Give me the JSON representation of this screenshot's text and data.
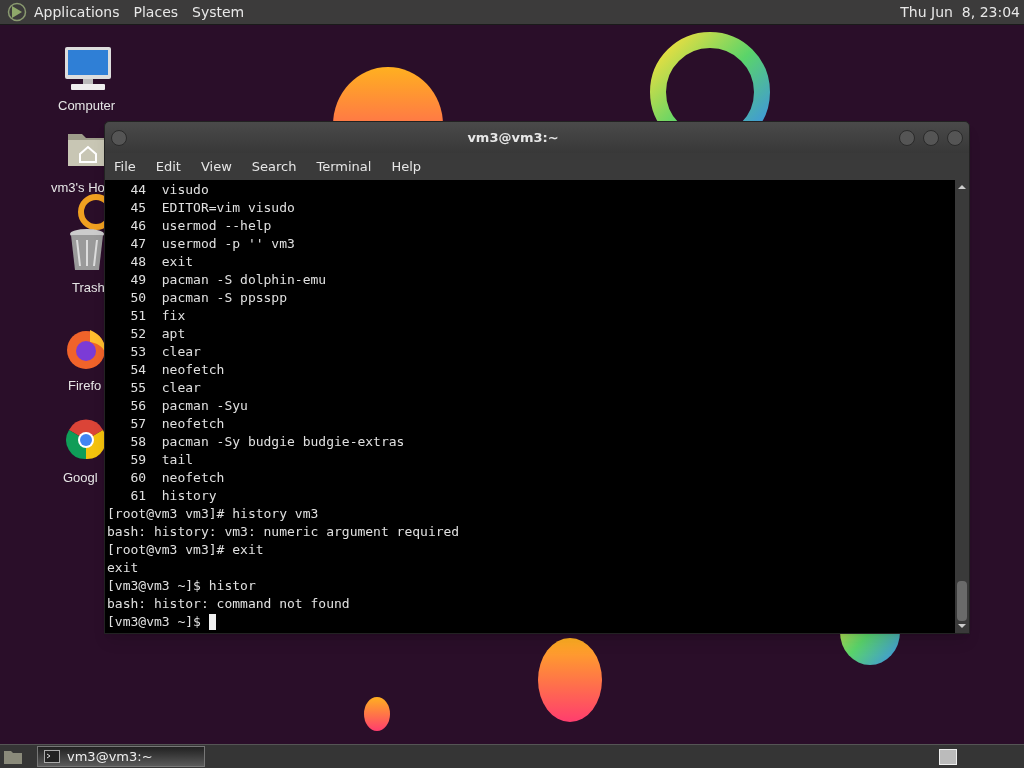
{
  "top_panel": {
    "menus": [
      "Applications",
      "Places",
      "System"
    ],
    "clock": "Thu Jun  8, 23:04"
  },
  "desktop_icons": [
    {
      "label": "Computer",
      "kind": "computer"
    },
    {
      "label": "vm3's Ho",
      "kind": "home"
    },
    {
      "label": "Trash",
      "kind": "trash"
    },
    {
      "label": "Firefo",
      "kind": "firefox"
    },
    {
      "label": "Googl",
      "kind": "chrome"
    }
  ],
  "window": {
    "title": "vm3@vm3:~",
    "menu": [
      "File",
      "Edit",
      "View",
      "Search",
      "Terminal",
      "Help"
    ],
    "lines": [
      "   44  visudo",
      "   45  EDITOR=vim visudo",
      "   46  usermod --help",
      "   47  usermod -p '' vm3",
      "   48  exit",
      "   49  pacman -S dolphin-emu",
      "   50  pacman -S ppsspp",
      "   51  fix",
      "   52  apt",
      "   53  clear",
      "   54  neofetch",
      "   55  clear",
      "   56  pacman -Syu",
      "   57  neofetch",
      "   58  pacman -Sy budgie budgie-extras",
      "   59  tail",
      "   60  neofetch",
      "   61  history",
      "[root@vm3 vm3]# history vm3",
      "bash: history: vm3: numeric argument required",
      "[root@vm3 vm3]# exit",
      "exit",
      "[vm3@vm3 ~]$ histor",
      "bash: histor: command not found",
      "[vm3@vm3 ~]$ "
    ]
  },
  "taskbar": {
    "tasks": [
      {
        "label": "vm3@vm3:~",
        "selected": true
      }
    ]
  }
}
